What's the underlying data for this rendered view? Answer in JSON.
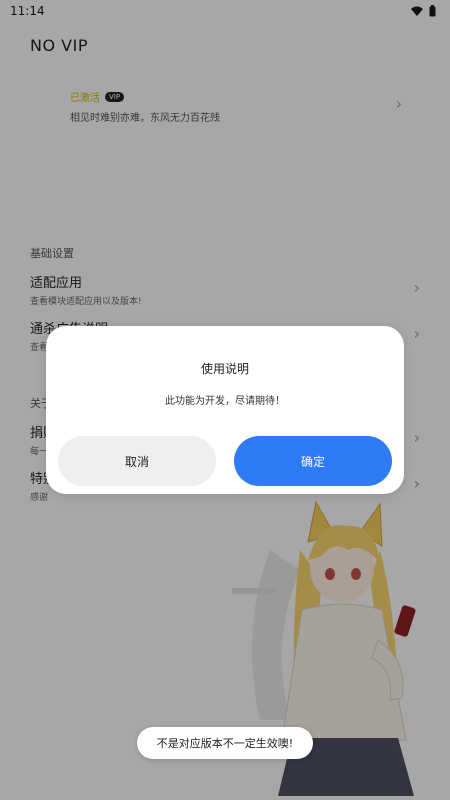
{
  "status_bar": {
    "time": "11:14"
  },
  "page": {
    "title": "NO VIP"
  },
  "vip_card": {
    "status": "已激活",
    "badge": "VIP",
    "description": "相见时难别亦难，东风无力百花残"
  },
  "basic_settings": {
    "section_title": "基础设置",
    "items": [
      {
        "title": "适配应用",
        "description": "查看模块适配应用以及版本!"
      },
      {
        "title": "通杀广告说明",
        "description": "查看"
      }
    ]
  },
  "about": {
    "section_title": "关于",
    "items": [
      {
        "title": "捐赠",
        "description": "每一"
      },
      {
        "title": "特别",
        "description": "感谢"
      }
    ]
  },
  "dialog": {
    "title": "使用说明",
    "message": "此功能为开发，尽请期待！",
    "cancel_label": "取消",
    "confirm_label": "确定"
  },
  "toast": {
    "message": "不是对应版本不一定生效噢!"
  },
  "colors": {
    "accent": "#2f7bf5",
    "vip_gold": "#c9b200",
    "background": "#f6f6f6",
    "hair": "#f0c85a"
  },
  "icons": {
    "wifi": "wifi-icon",
    "battery": "battery-icon",
    "chevron": "chevron-right-icon"
  }
}
